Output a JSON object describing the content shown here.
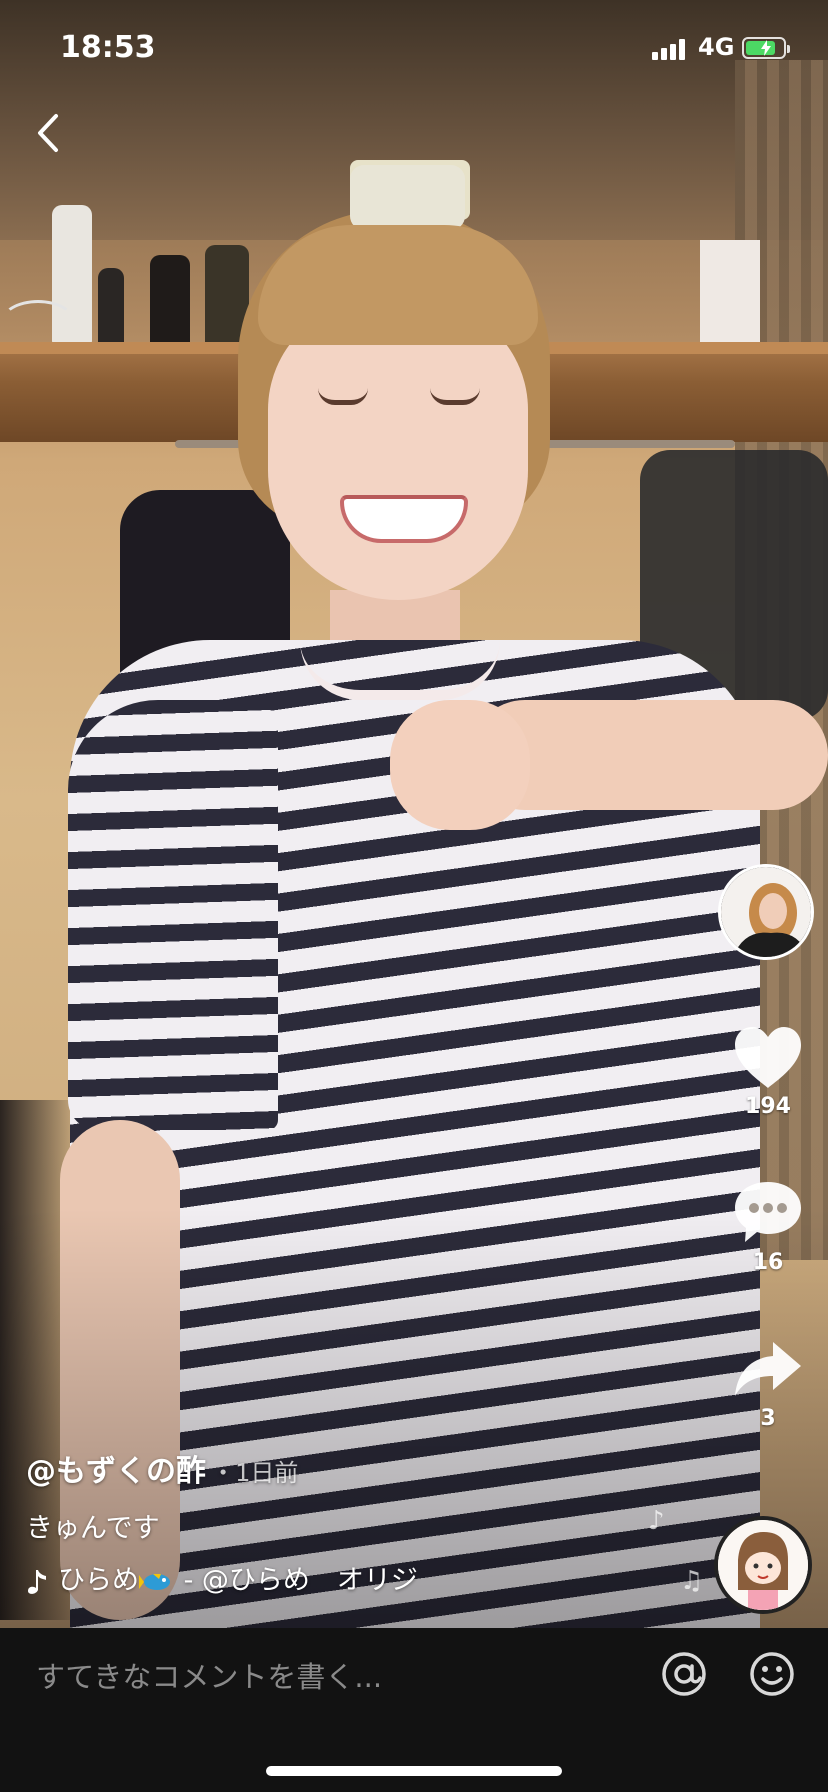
{
  "status_bar": {
    "time": "18:53",
    "network": "4G",
    "battery_level": 0.8
  },
  "video": {
    "creator_handle": "@もずくの酢",
    "time_ago": "・1日前",
    "description": "きゅんです",
    "music": {
      "song": "ひらめ",
      "artist": "- @ひらめ　オリジ"
    }
  },
  "actions": {
    "likes": "194",
    "comments": "16",
    "shares": "3"
  },
  "comment_bar": {
    "placeholder": "すてきなコメントを書く..."
  },
  "colors": {
    "accent": "#ffffff",
    "battery": "#4cd964",
    "comment_bar_bg": "#121212"
  },
  "icons": [
    "back-icon",
    "heart-icon",
    "comment-icon",
    "share-icon",
    "music-note-icon",
    "at-icon",
    "emoji-icon"
  ]
}
